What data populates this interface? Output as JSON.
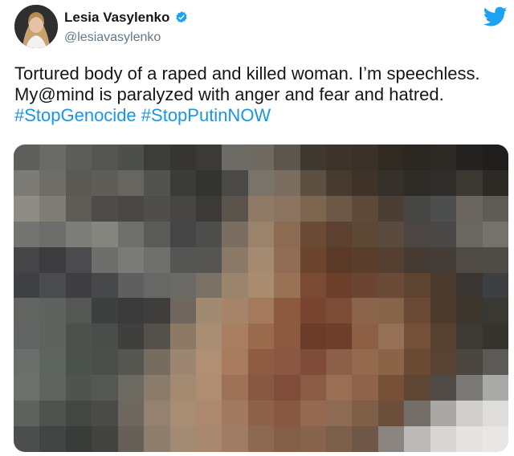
{
  "author": {
    "name": "Lesia Vasylenko",
    "handle": "@lesiavasylenko",
    "verified": true
  },
  "tweet": {
    "text_part1": "Tortured body of a raped and killed woman. I’m speechless. My@mind is paralyzed with anger and fear and hatred.",
    "hashtags": [
      "#StopGenocide",
      "#StopPutinNOW"
    ]
  },
  "icons": {
    "verified": "verified-badge-icon",
    "brand": "twitter-bird-icon"
  },
  "colors": {
    "brand": "#1da1f2",
    "hashtag": "#1b95e0",
    "name": "#14171a",
    "handle": "#657786"
  },
  "media": {
    "description_hidden": true,
    "pixel_colors": [
      "#5e5e5b",
      "#6a6a66",
      "#5c5c58",
      "#555551",
      "#4d4f4b",
      "#3c3c39",
      "#363532",
      "#3b3a37",
      "#6d6b65",
      "#6e6a62",
      "#5d564d",
      "#3f3830",
      "#3d332a",
      "#3a3128",
      "#302a23",
      "#2a2620",
      "#2c2925",
      "#242220",
      "#1f1e1c",
      "#7d7b76",
      "#6f6d68",
      "#5a5954",
      "#5e5d58",
      "#666560",
      "#525350",
      "#3b3b39",
      "#333330",
      "#4b4946",
      "#7a736a",
      "#7b6d5f",
      "#5d4f41",
      "#473a2e",
      "#3e3229",
      "#35302a",
      "#2e2b27",
      "#2f2d29",
      "#3b3731",
      "#2d2a26",
      "#8f8b85",
      "#807c76",
      "#5e5c57",
      "#4d4c48",
      "#484744",
      "#4f4e4b",
      "#474644",
      "#3b3a38",
      "#5a544d",
      "#8f7a66",
      "#8c7560",
      "#7c6650",
      "#6d5847",
      "#5e4a3a",
      "#4b3e33",
      "#464645",
      "#4d4e4e",
      "#6a6560",
      "#5f5c58",
      "#737372",
      "#6d6d6b",
      "#7c7d79",
      "#85857f",
      "#6f706c",
      "#5a5a58",
      "#454545",
      "#4d4d4c",
      "#7a6d61",
      "#9a826b",
      "#8b6c52",
      "#6b4a35",
      "#5c4030",
      "#5d4735",
      "#5a4b3e",
      "#4b4644",
      "#4a4847",
      "#6a6761",
      "#75726d",
      "#454548",
      "#3c3c3f",
      "#4b4b4d",
      "#6e6f6d",
      "#7a7b78",
      "#6f6f6d",
      "#555554",
      "#575552",
      "#8a7966",
      "#a38a70",
      "#8f6c53",
      "#6b452e",
      "#5b3a27",
      "#5a3d2b",
      "#553f30",
      "#463b33",
      "#443d38",
      "#514b45",
      "#4f4b47",
      "#3f4043",
      "#4a4b4c",
      "#3e3e40",
      "#47484a",
      "#5e5f5e",
      "#676765",
      "#6b6a67",
      "#7b7266",
      "#9a846c",
      "#a98b6f",
      "#9a7357",
      "#7a4b32",
      "#6c3f2a",
      "#6c4532",
      "#6a4b37",
      "#5d4430",
      "#4b3a2e",
      "#383532",
      "#3e3f42",
      "#626461",
      "#606260",
      "#555755",
      "#3e3f3f",
      "#3a3a3b",
      "#3f3e3d",
      "#6f675d",
      "#a08a72",
      "#a58469",
      "#a37a5c",
      "#8d5a3f",
      "#7a4530",
      "#7d4c36",
      "#8b654b",
      "#876448",
      "#6a4a34",
      "#4c3a2c",
      "#3b352c",
      "#3a3832",
      "#626563",
      "#5f625f",
      "#4d504d",
      "#4a4d4a",
      "#3f403e",
      "#54514b",
      "#8c7a66",
      "#a98d72",
      "#a87e61",
      "#9a6a4d",
      "#8d5a40",
      "#6c3c2a",
      "#6f3e2b",
      "#8c5f45",
      "#967054",
      "#755038",
      "#574131",
      "#3d3a33",
      "#35342f",
      "#6a6f6c",
      "#5e6561",
      "#4b514d",
      "#4a4f4b",
      "#555650",
      "#766d60",
      "#9c8671",
      "#b08f74",
      "#a97b5e",
      "#8f5c42",
      "#8a5742",
      "#7e4c38",
      "#8b5f48",
      "#95694e",
      "#8b6346",
      "#6b4a34",
      "#564334",
      "#4b4540",
      "#5b5a57",
      "#6c716d",
      "#5f6460",
      "#4f5450",
      "#545752",
      "#6d6a61",
      "#8b7b6a",
      "#a58a72",
      "#b08c70",
      "#9e7256",
      "#885843",
      "#7f4d3a",
      "#8a5c44",
      "#9a6e53",
      "#8e6349",
      "#765138",
      "#5d4634",
      "#4f4a45",
      "#7a7977",
      "#a9a9a7",
      "#5f6360",
      "#4f524f",
      "#434643",
      "#4a4b48",
      "#6e675e",
      "#94816f",
      "#a88d74",
      "#ab886e",
      "#a17960",
      "#8d614a",
      "#87583f",
      "#94694f",
      "#8d6a53",
      "#7f5e48",
      "#6b4f3b",
      "#746e68",
      "#a9a8a5",
      "#cfcecb",
      "#dedddb",
      "#4c4f4d",
      "#424543",
      "#3a3c3a",
      "#42423f",
      "#655f57",
      "#8d7d6d",
      "#a28a73",
      "#a8896f",
      "#9f7c63",
      "#8d6852",
      "#845f48",
      "#87644d",
      "#7c5f4a",
      "#6f5747",
      "#8a8580",
      "#bcbbb8",
      "#d8d7d4",
      "#e5e4e2",
      "#e8e7e5"
    ]
  }
}
